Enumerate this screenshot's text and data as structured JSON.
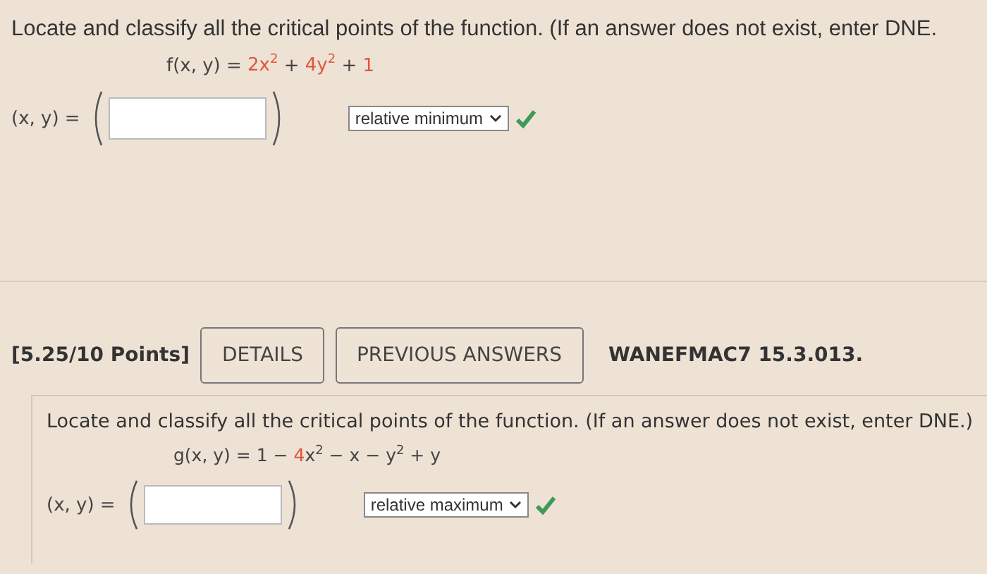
{
  "questions": [
    {
      "prompt": "Locate and classify all the critical points of the function. (If an answer does not exist, enter DNE.",
      "formula": [
        {
          "text": "f(x, y) = ",
          "highlight": false
        },
        {
          "text": "2x$^{2}$",
          "highlight": true
        },
        {
          "text": " + ",
          "highlight": false
        },
        {
          "text": "4y$^{2}$",
          "highlight": true
        },
        {
          "text": " + ",
          "highlight": false
        },
        {
          "text": "1",
          "highlight": true
        }
      ],
      "answer_label": "(x, y) =",
      "classification": "relative minimum",
      "correct": true
    },
    {
      "header": {
        "points": "[5.25/10 Points]",
        "buttons": [
          "DETAILS",
          "PREVIOUS ANSWERS"
        ],
        "code": "WANEFMAC7 15.3.013."
      },
      "prompt": "Locate and classify all the critical points of the function. (If an answer does not exist, enter DNE.)",
      "formula": [
        {
          "text": "g(x, y) = 1 − ",
          "highlight": false
        },
        {
          "text": "4",
          "highlight": true
        },
        {
          "text": "x$^{2}$ − x − y$^{2}$ + y",
          "highlight": false
        }
      ],
      "answer_label": "(x, y) =",
      "classification": "relative maximum",
      "correct": true
    }
  ]
}
